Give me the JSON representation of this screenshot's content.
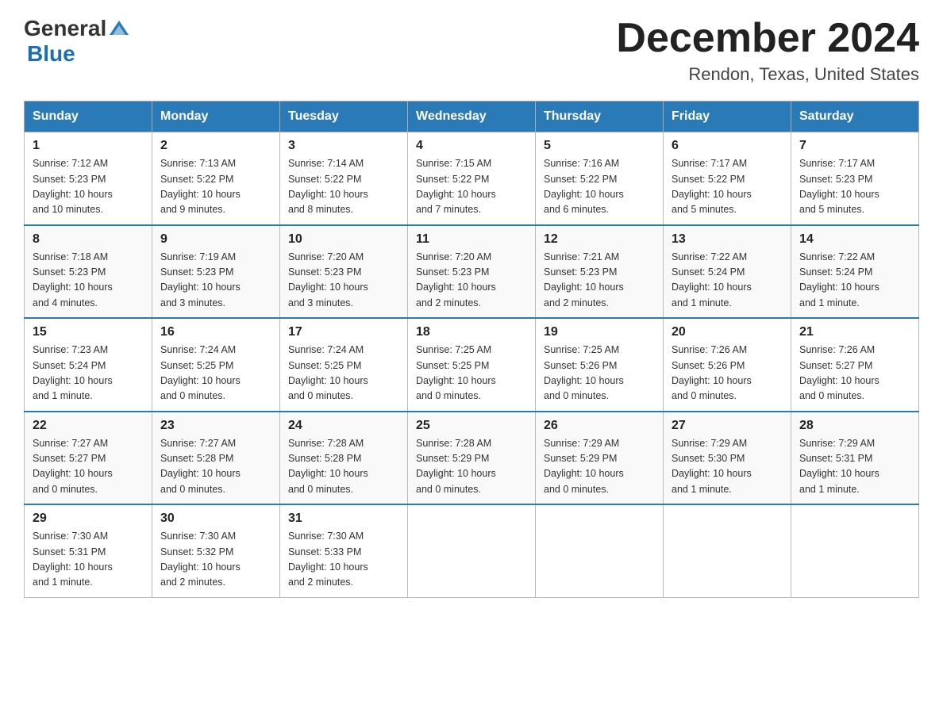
{
  "header": {
    "logo": {
      "general": "General",
      "blue": "Blue",
      "triangle_color": "#2a7ab8"
    },
    "title": "December 2024",
    "location": "Rendon, Texas, United States"
  },
  "weekdays": [
    "Sunday",
    "Monday",
    "Tuesday",
    "Wednesday",
    "Thursday",
    "Friday",
    "Saturday"
  ],
  "rows": [
    [
      {
        "day": "1",
        "sunrise": "7:12 AM",
        "sunset": "5:23 PM",
        "daylight": "10 hours and 10 minutes."
      },
      {
        "day": "2",
        "sunrise": "7:13 AM",
        "sunset": "5:22 PM",
        "daylight": "10 hours and 9 minutes."
      },
      {
        "day": "3",
        "sunrise": "7:14 AM",
        "sunset": "5:22 PM",
        "daylight": "10 hours and 8 minutes."
      },
      {
        "day": "4",
        "sunrise": "7:15 AM",
        "sunset": "5:22 PM",
        "daylight": "10 hours and 7 minutes."
      },
      {
        "day": "5",
        "sunrise": "7:16 AM",
        "sunset": "5:22 PM",
        "daylight": "10 hours and 6 minutes."
      },
      {
        "day": "6",
        "sunrise": "7:17 AM",
        "sunset": "5:22 PM",
        "daylight": "10 hours and 5 minutes."
      },
      {
        "day": "7",
        "sunrise": "7:17 AM",
        "sunset": "5:23 PM",
        "daylight": "10 hours and 5 minutes."
      }
    ],
    [
      {
        "day": "8",
        "sunrise": "7:18 AM",
        "sunset": "5:23 PM",
        "daylight": "10 hours and 4 minutes."
      },
      {
        "day": "9",
        "sunrise": "7:19 AM",
        "sunset": "5:23 PM",
        "daylight": "10 hours and 3 minutes."
      },
      {
        "day": "10",
        "sunrise": "7:20 AM",
        "sunset": "5:23 PM",
        "daylight": "10 hours and 3 minutes."
      },
      {
        "day": "11",
        "sunrise": "7:20 AM",
        "sunset": "5:23 PM",
        "daylight": "10 hours and 2 minutes."
      },
      {
        "day": "12",
        "sunrise": "7:21 AM",
        "sunset": "5:23 PM",
        "daylight": "10 hours and 2 minutes."
      },
      {
        "day": "13",
        "sunrise": "7:22 AM",
        "sunset": "5:24 PM",
        "daylight": "10 hours and 1 minute."
      },
      {
        "day": "14",
        "sunrise": "7:22 AM",
        "sunset": "5:24 PM",
        "daylight": "10 hours and 1 minute."
      }
    ],
    [
      {
        "day": "15",
        "sunrise": "7:23 AM",
        "sunset": "5:24 PM",
        "daylight": "10 hours and 1 minute."
      },
      {
        "day": "16",
        "sunrise": "7:24 AM",
        "sunset": "5:25 PM",
        "daylight": "10 hours and 0 minutes."
      },
      {
        "day": "17",
        "sunrise": "7:24 AM",
        "sunset": "5:25 PM",
        "daylight": "10 hours and 0 minutes."
      },
      {
        "day": "18",
        "sunrise": "7:25 AM",
        "sunset": "5:25 PM",
        "daylight": "10 hours and 0 minutes."
      },
      {
        "day": "19",
        "sunrise": "7:25 AM",
        "sunset": "5:26 PM",
        "daylight": "10 hours and 0 minutes."
      },
      {
        "day": "20",
        "sunrise": "7:26 AM",
        "sunset": "5:26 PM",
        "daylight": "10 hours and 0 minutes."
      },
      {
        "day": "21",
        "sunrise": "7:26 AM",
        "sunset": "5:27 PM",
        "daylight": "10 hours and 0 minutes."
      }
    ],
    [
      {
        "day": "22",
        "sunrise": "7:27 AM",
        "sunset": "5:27 PM",
        "daylight": "10 hours and 0 minutes."
      },
      {
        "day": "23",
        "sunrise": "7:27 AM",
        "sunset": "5:28 PM",
        "daylight": "10 hours and 0 minutes."
      },
      {
        "day": "24",
        "sunrise": "7:28 AM",
        "sunset": "5:28 PM",
        "daylight": "10 hours and 0 minutes."
      },
      {
        "day": "25",
        "sunrise": "7:28 AM",
        "sunset": "5:29 PM",
        "daylight": "10 hours and 0 minutes."
      },
      {
        "day": "26",
        "sunrise": "7:29 AM",
        "sunset": "5:29 PM",
        "daylight": "10 hours and 0 minutes."
      },
      {
        "day": "27",
        "sunrise": "7:29 AM",
        "sunset": "5:30 PM",
        "daylight": "10 hours and 1 minute."
      },
      {
        "day": "28",
        "sunrise": "7:29 AM",
        "sunset": "5:31 PM",
        "daylight": "10 hours and 1 minute."
      }
    ],
    [
      {
        "day": "29",
        "sunrise": "7:30 AM",
        "sunset": "5:31 PM",
        "daylight": "10 hours and 1 minute."
      },
      {
        "day": "30",
        "sunrise": "7:30 AM",
        "sunset": "5:32 PM",
        "daylight": "10 hours and 2 minutes."
      },
      {
        "day": "31",
        "sunrise": "7:30 AM",
        "sunset": "5:33 PM",
        "daylight": "10 hours and 2 minutes."
      },
      null,
      null,
      null,
      null
    ]
  ],
  "labels": {
    "sunrise": "Sunrise:",
    "sunset": "Sunset:",
    "daylight": "Daylight:"
  }
}
